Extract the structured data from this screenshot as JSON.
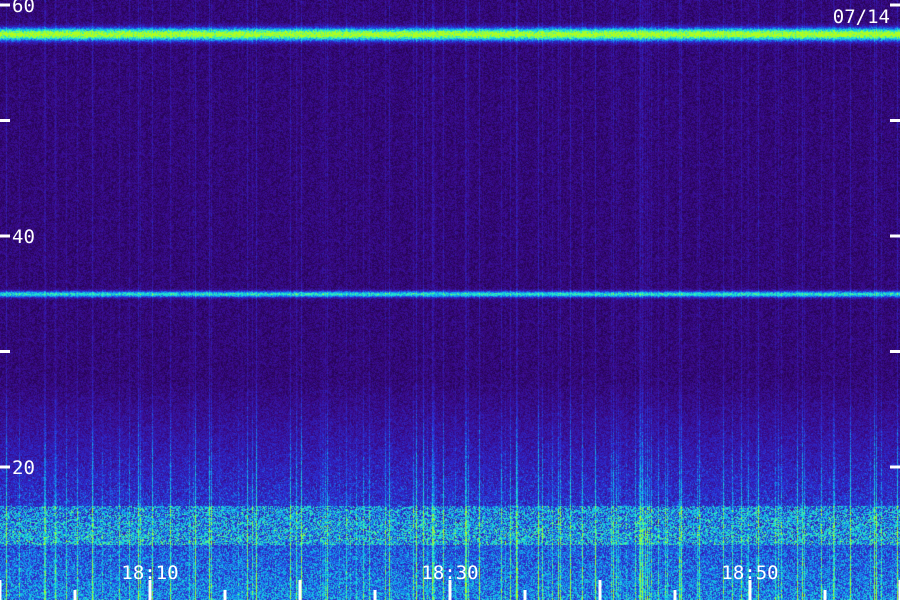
{
  "chart_data": {
    "type": "heatmap",
    "title": "",
    "date": "07/14",
    "xlabel": "",
    "ylabel": "",
    "y_ticks": [
      {
        "value": 60,
        "label": "60"
      },
      {
        "value": 50,
        "label": ""
      },
      {
        "value": 40,
        "label": "40"
      },
      {
        "value": 30,
        "label": ""
      },
      {
        "value": 20,
        "label": "20"
      }
    ],
    "x_ticks": [
      {
        "value": "18:10",
        "label": "18:10"
      },
      {
        "value": "18:30",
        "label": "18:30"
      },
      {
        "value": "18:50",
        "label": "18:50"
      }
    ],
    "x_range": [
      "18:00",
      "19:00"
    ],
    "y_range": [
      5,
      60
    ],
    "colormap": [
      "#000000",
      "#1a0030",
      "#3a0a8a",
      "#2a30d8",
      "#10a8f0",
      "#28f0c8",
      "#b0ff20"
    ],
    "horizontal_bands": [
      {
        "y": 57.5,
        "intensity": 0.85
      },
      {
        "y": 35,
        "intensity": 0.55
      },
      {
        "y": 8,
        "intensity": 0.9
      }
    ],
    "grid": false,
    "legend": "none"
  }
}
